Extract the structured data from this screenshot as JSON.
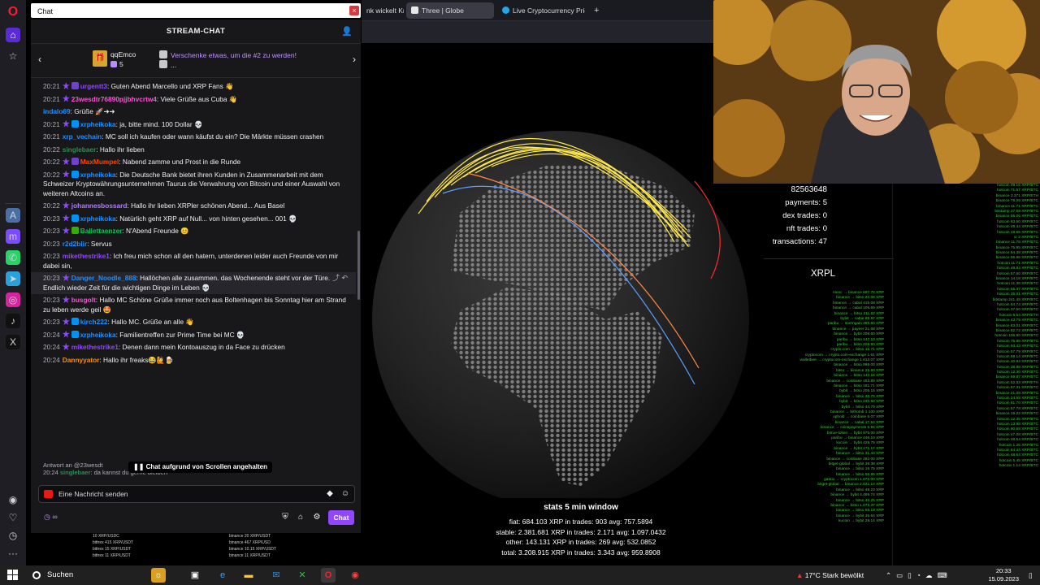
{
  "browser": {
    "tabs": [
      {
        "label": "nk wickelt Kr"
      },
      {
        "label": "Three | Globe"
      },
      {
        "label": "Live Cryptocurrency Price"
      }
    ],
    "new_tab_symbol": "+"
  },
  "chat": {
    "search_value": "Chat",
    "close_symbol": "×",
    "header_title": "STREAM-CHAT",
    "gift": {
      "user": "qqEmco",
      "count": "5",
      "promo": "Verschenke etwas, um die #2 zu werden!",
      "promo_sub": "..."
    },
    "messages": [
      {
        "time": "20:21",
        "badges": [
          "star",
          "sub"
        ],
        "user": "urgentt3",
        "user_color": "#9147ff",
        "text": "Guten Abend Marcello und XRP Fans 👋"
      },
      {
        "time": "20:21",
        "badges": [
          "star"
        ],
        "user": "23wesdtr76890pjjbhvcrtw4",
        "user_color": "#ff4fd8",
        "text": "Viele Grüße aus Cuba 👋"
      },
      {
        "time": "",
        "badges": [],
        "user": "indalo69",
        "user_color": "#1e90ff",
        "text": "Grüße 🚀➜➜"
      },
      {
        "time": "20:21",
        "badges": [
          "star",
          "prime"
        ],
        "user": "xrpheikoka",
        "user_color": "#1e90ff",
        "text": "ja, bitte mind. 100 Dollar 💀"
      },
      {
        "time": "20:21",
        "badges": [],
        "user": "xrp_vechain",
        "user_color": "#1e90ff",
        "text": "MC soll ich kaufen oder wann käufst du ein? Die Märkte müssen crashen"
      },
      {
        "time": "20:22",
        "badges": [],
        "user": "singlebaer",
        "user_color": "#2e8b57",
        "text": "Hallo ihr lieben"
      },
      {
        "time": "20:22",
        "badges": [
          "star",
          "sub"
        ],
        "user": "MaxMumpel",
        "user_color": "#ff4500",
        "text": "Nabend zamme und Prost in die Runde"
      },
      {
        "time": "20:22",
        "badges": [
          "star",
          "prime"
        ],
        "user": "xrpheikoka",
        "user_color": "#1e90ff",
        "text": "Die Deutsche Bank bietet ihren Kunden in Zusammenarbeit mit dem Schweizer Kryptowährungsunternehmen Taurus die Verwahrung von Bitcoin und einer Auswahl von weiteren Altcoins an."
      },
      {
        "time": "20:22",
        "badges": [
          "star"
        ],
        "user": "johannesbossard",
        "user_color": "#b07cff",
        "text": "Hallo ihr lieben XRPler schönen Abend... Aus Basel"
      },
      {
        "time": "20:23",
        "badges": [
          "star",
          "prime"
        ],
        "user": "xrpheikoka",
        "user_color": "#1e90ff",
        "text": "Natürlich geht XRP auf Null... von hinten gesehen... 001 💀"
      },
      {
        "time": "20:23",
        "badges": [
          "star",
          "mod"
        ],
        "user": "Ballettaenzer",
        "user_color": "#00c853",
        "text": "N'Abend Freunde 😊"
      },
      {
        "time": "20:23",
        "badges": [],
        "user": "r2d2blir",
        "user_color": "#1e90ff",
        "text": "Servus"
      },
      {
        "time": "20:23",
        "badges": [],
        "user": "mikethestrike1",
        "user_color": "#9147ff",
        "text": "Ich freu mich schon all den hatern, unterdenen leider auch Freunde von mir dabei sin,"
      },
      {
        "time": "20:23",
        "badges": [
          "star"
        ],
        "user": "Danger_Noodle_888",
        "user_color": "#1e90ff",
        "text": "Hallöchen alle zusammen. das Wochenende steht vor der Türe. Endlich wieder Zeit für die wichtigen Dinge im Leben 💀",
        "highlight": true
      },
      {
        "time": "20:23",
        "badges": [
          "star"
        ],
        "user": "busgolt",
        "user_color": "#ff4fd8",
        "text": "Hallo MC Schöne Grüße immer noch aus Boltenhagen bis Sonntag hier am Strand zu leben werde geil 🤩"
      },
      {
        "time": "20:23",
        "badges": [
          "star",
          "prime"
        ],
        "user": "kirch222",
        "user_color": "#1e90ff",
        "text": "Hallo MC. Grüße an alle 👋"
      },
      {
        "time": "20:24",
        "badges": [
          "star",
          "prime"
        ],
        "user": "xrpheikoka",
        "user_color": "#1e90ff",
        "text": "Familientreffen zur Prime Time bei MC 💀"
      },
      {
        "time": "20:24",
        "badges": [
          "star"
        ],
        "user": "mikethestrike1",
        "user_color": "#9147ff",
        "text": "Denen dann mein Kontoauszug in da Face zu drücken"
      },
      {
        "time": "20:24",
        "badges": [],
        "user": "Dannyyator",
        "user_color": "#ff8c00",
        "text": "Hallo ihr freaks😂🙋🍺"
      }
    ],
    "reply_preview": "Antwort an @23wesdt",
    "last_message": {
      "time": "20:24",
      "user": "singlebaer",
      "text": "da kannst du gerne bleiben"
    },
    "paused_label": "Chat aufgrund von Scrollen angehalten",
    "input_placeholder": "Eine Nachricht senden",
    "points": "∞",
    "send_label": "Chat"
  },
  "viz": {
    "stats_title": "stats 5 min window",
    "stats_rows": [
      "fiat: 684.103 XRP in trades: 903 avg: 757.5894",
      "stable: 2.381.681 XRP in trades: 2.171 avg: 1.097.0432",
      "other: 143.131 XRP in trades: 269 avg: 532.0852",
      "total: 3.208.915 XRP in trades: 3.343 avg: 959.8908"
    ]
  },
  "xrpl": {
    "ledger": "82563648",
    "payments": "payments: 5",
    "dex_trades": "dex trades: 0",
    "nft_trades": "nft trades: 0",
    "transactions": "transactions: 47",
    "label": "XRPL",
    "flow_left": [
      "mexc → binance 697.76 XRP",
      "binance → bitso 20.08 XRP",
      "binance → cabal 415.08 XRP",
      "binance → cabal 105.69 XRP",
      "binance → bitso 211.62 XRP",
      "bybit → cabal 88.87 XRP",
      "paribu → stormgain 369.60 XRP",
      "binance → payeer 21.68 XRP",
      "binance → bybit 208.60 XRP",
      "paribu → bitso 147.10 XRP",
      "paribu → bitso 208.90 XRP",
      "crypto.com → bitso 15.71 XRP",
      "cryptocom → crypto.com-exchange 1.61 XRP",
      "walletbee → cryptocom-exchange 1.813.07 XRP",
      "binance → bitso 999.00 XRP",
      "bitso → binance 25.50 XRP",
      "binance → bitso 140.16 XRP",
      "binance → coinbase 153.89 XRP",
      "binance → bitso 181.71 XRP",
      "bybit → bitso 205.15 XRP",
      "binance → bitso 36.75 XRP",
      "bybit → bitso 230.83 XRP",
      "bybit → bitso 44.79 XRP",
      "binance → bithomb 1.100 XRP",
      "uphold → coinbase 6.07 XRP",
      "binance → cabal 17.54 XRP",
      "binance → coinspayments 6.94 XRP",
      "bitrue-token → bybit 975.00 XRP",
      "paribu → binance 446.10 XRP",
      "kucoin → bybit 429.79 XRP",
      "binance → bybit 171.17 XRP",
      "binance → bitso 31.43 XRP",
      "binance → coinbase 282.00 XRP",
      "bitget-global → bybit 39.38 XRP",
      "binance → bitso 19.75 XRP",
      "binance → bitso 56.86 XRP",
      "gateio → cryptocom 1.072.00 XRP",
      "bitget-global → binance 2.021.14 XRP",
      "binance → bitso 48.23 XRP",
      "binance → bybit 4.469.74 XRP",
      "binance → bitso 40.25 XRP",
      "binance → bitso 1.073.37 XRP",
      "binance → bitso 69.19 XRP",
      "binance → bybit 36.64 XRP",
      "kucoin → bybit 28.14 XRP"
    ],
    "flow_right": [
      "hotcoin 49.16 XRP/BTC",
      "hotcoin 71.57 XRP/BTC",
      "binance 3.371 XRP/ETH",
      "binance 78.09 XRP/BTC",
      "binance 11.71 XRP/BTC",
      "bitstamp 27.59 XRP/BTC",
      "binance 55.06 XRP/BTC",
      "hotcoin 63.50 XRP/BTC",
      "hotcoin 49.44 XRP/BTC",
      "hotcoin 18.96 XRP/BTC",
      "cr 2 XRP/BTC",
      "binance 11.78 XRP/BTC",
      "binance 75.95 XRP/BTC",
      "binance 64.38 XRP/BTC",
      "binance 55.96 XRP/BTC",
      "hotcoin 11.71 XRP/BTC",
      "hotcoin 49.84 XRP/BTC",
      "hotcoin 57.60 XRP/BTC",
      "binance 14.18 XRP/BTC",
      "hotcoin 11.36 XRP/BTC",
      "hotcoin 55.37 XRP/BTC",
      "hotcoin 35.01 XRP/BTC",
      "bitstamp 241.48 XRP/BTC",
      "hotcoin 64.74 XRP/BTC",
      "hotcoin 37.50 XRP/BTC",
      "hotcoin 6.54 XRP/ETH",
      "binance 43.79 XRP/BTC",
      "binance 83.01 XRP/BTC",
      "binance 92.72 XRP/BTC",
      "hotcoin 106.90 XRP/BTC",
      "hotcoin 75.86 XRP/BTC",
      "hotcoin 93.43 XRP/BTC",
      "hotcoin 57.79 XRP/BTC",
      "hotcoin 69.14 XRP/BTC",
      "hotcoin 40.94 XRP/BTC",
      "hotcoin 38.88 XRP/BTC",
      "hotcoin 12.30 XRP/BTC",
      "binance 69.87 XRP/BTC",
      "hotcoin 52.33 XRP/ETH",
      "hotcoin 67.31 XRP/BTC",
      "binance 21.08 XRP/BTC",
      "hotcoin 24.58 XRP/BTC",
      "hotcoin 61.70 XRP/BTC",
      "hotcoin 57.78 XRP/BTC",
      "binance 19.22 XRP/BTC",
      "hotcoin 12.35 XRP/BTC",
      "hotcoin 13.98 XRP/BTC",
      "hotcoin 90.68 XRP/BTC",
      "hotcoin 47.08 XRP/BTC",
      "hotcoin 48.54 XRP/BTC",
      "hotcoin 1.26 XRP/BTC",
      "hotcoin 64.44 XRP/BTC",
      "hotcoin 48.64 XRP/BTC",
      "hotcoin 5.45 XRP/BTC",
      "hotcoin 1.14 XRP/BTC"
    ],
    "bottom_left": [
      "10 XRP/USDC",
      "bittrex 415 XRP/USDT",
      "bittrex 15 XRP/USDT",
      "bittrex 11 XRP/USDT"
    ],
    "bottom_right": [
      "binance 20 XRP/USDT",
      "binance 467 XRP/USD",
      "binance 10.15 XRP/USDT",
      "binance 11 XRP/USDT"
    ]
  },
  "colors": {
    "accent": "#9147ff",
    "flow_green": "#3cc83c",
    "arc_yellow": "#ffe94a",
    "arc_red": "#ff2a2a",
    "arc_blue": "#5aa0ff"
  },
  "taskbar": {
    "search_label": "Suchen",
    "weather": "17°C  Stark bewölkt",
    "time": "20:33",
    "date": "15.09.2023"
  }
}
